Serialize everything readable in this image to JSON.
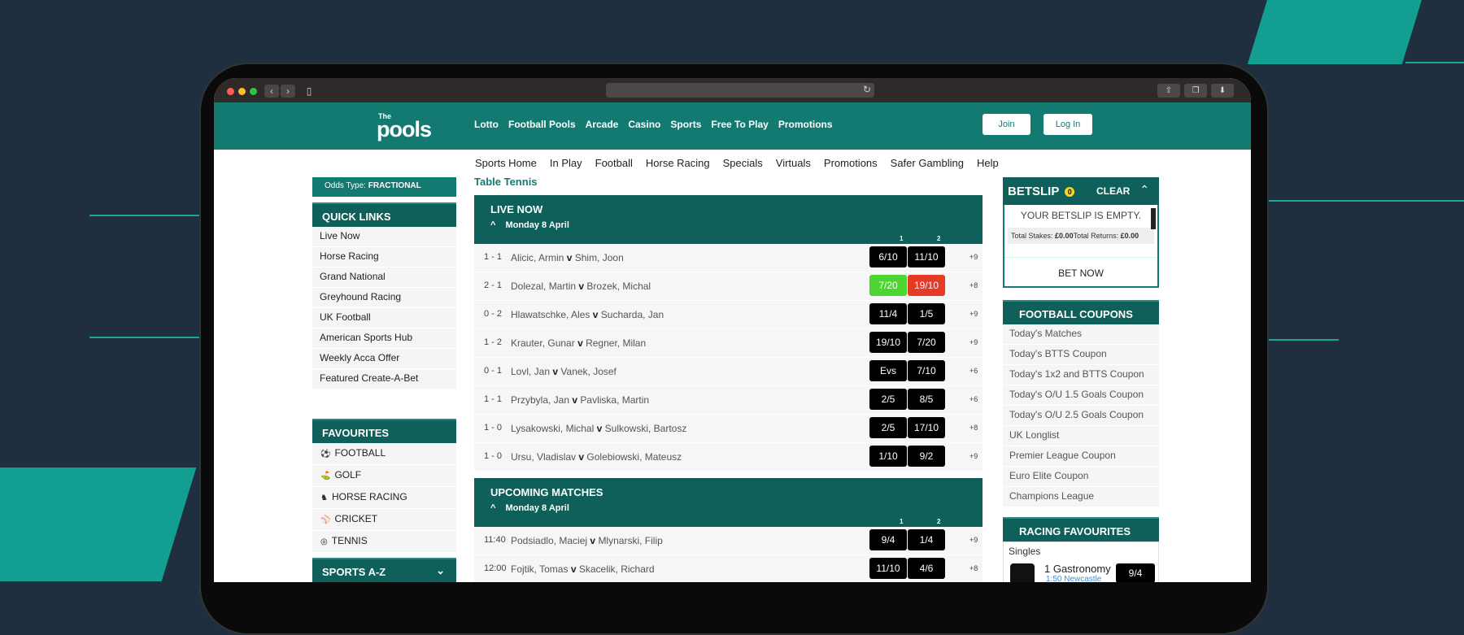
{
  "browser": {
    "back_icon": "chevron-left-icon",
    "forward_icon": "chevron-right-icon",
    "reload_icon": "reload-icon"
  },
  "header": {
    "logo_the": "The",
    "logo_pools": "pools",
    "nav": [
      "Lotto",
      "Football Pools",
      "Arcade",
      "Casino",
      "Sports",
      "Free To Play",
      "Promotions"
    ],
    "join": "Join",
    "login": "Log In"
  },
  "subnav": [
    "Sports Home",
    "In Play",
    "Football",
    "Horse Racing",
    "Specials",
    "Virtuals",
    "Promotions",
    "Safer Gambling",
    "Help"
  ],
  "sidebar": {
    "odds_type_label": "Odds Type:",
    "odds_type_value": "FRACTIONAL",
    "quick_links_title": "QUICK LINKS",
    "quick_links": [
      "Live Now",
      "Horse Racing",
      "Grand National",
      "Greyhound Racing",
      "UK Football",
      "American Sports Hub",
      "Weekly Acca Offer",
      "Featured Create-A-Bet"
    ],
    "favourites_title": "FAVOURITES",
    "favourites": [
      {
        "label": "FOOTBALL",
        "icon": "football-icon",
        "glyph": "⚽"
      },
      {
        "label": "GOLF",
        "icon": "golf-icon",
        "glyph": "⛳"
      },
      {
        "label": "HORSE RACING",
        "icon": "horse-icon",
        "glyph": "♞"
      },
      {
        "label": "CRICKET",
        "icon": "cricket-icon",
        "glyph": "⚾"
      },
      {
        "label": "TENNIS",
        "icon": "tennis-icon",
        "glyph": "◎"
      }
    ],
    "sports_az": "SPORTS A-Z"
  },
  "main": {
    "section_title": "Table Tennis",
    "live_title": "LIVE NOW",
    "live_date": "Monday 8 April",
    "col1": "1",
    "col2": "2",
    "live_matches": [
      {
        "score": "1 - 1",
        "home": "Alicic, Armin",
        "away": "Shim, Joon",
        "odd1": "6/10",
        "odd2": "11/10",
        "more": "+9",
        "c1": "",
        "c2": ""
      },
      {
        "score": "2 - 1",
        "home": "Dolezal, Martin",
        "away": "Brozek, Michal",
        "odd1": "7/20",
        "odd2": "19/10",
        "more": "+8",
        "c1": "green",
        "c2": "red"
      },
      {
        "score": "0 - 2",
        "home": "Hlawatschke, Ales",
        "away": "Sucharda, Jan",
        "odd1": "11/4",
        "odd2": "1/5",
        "more": "+9",
        "c1": "",
        "c2": ""
      },
      {
        "score": "1 - 2",
        "home": "Krauter, Gunar",
        "away": "Regner, Milan",
        "odd1": "19/10",
        "odd2": "7/20",
        "more": "+9",
        "c1": "",
        "c2": ""
      },
      {
        "score": "0 - 1",
        "home": "Lovl, Jan",
        "away": "Vanek, Josef",
        "odd1": "Evs",
        "odd2": "7/10",
        "more": "+6",
        "c1": "",
        "c2": ""
      },
      {
        "score": "1 - 1",
        "home": "Przybyla, Jan",
        "away": "Pavliska, Martin",
        "odd1": "2/5",
        "odd2": "8/5",
        "more": "+6",
        "c1": "",
        "c2": ""
      },
      {
        "score": "1 - 0",
        "home": "Lysakowski, Michal",
        "away": "Sulkowski, Bartosz",
        "odd1": "2/5",
        "odd2": "17/10",
        "more": "+8",
        "c1": "",
        "c2": ""
      },
      {
        "score": "1 - 0",
        "home": "Ursu, Vladislav",
        "away": "Golebiowski, Mateusz",
        "odd1": "1/10",
        "odd2": "9/2",
        "more": "+9",
        "c1": "",
        "c2": ""
      }
    ],
    "upcoming_title": "UPCOMING MATCHES",
    "upcoming_date": "Monday 8 April",
    "upcoming_matches": [
      {
        "score": "11:40",
        "home": "Podsiadlo, Maciej",
        "away": "Mlynarski, Filip",
        "odd1": "9/4",
        "odd2": "1/4",
        "more": "+9",
        "c1": "",
        "c2": ""
      },
      {
        "score": "12:00",
        "home": "Fojtik, Tomas",
        "away": "Skacelik, Richard",
        "odd1": "11/10",
        "odd2": "4/6",
        "more": "+8",
        "c1": "",
        "c2": ""
      }
    ],
    "v": "v"
  },
  "betslip": {
    "title": "BETSLIP",
    "count": "0",
    "clear": "CLEAR",
    "empty": "YOUR BETSLIP IS EMPTY.",
    "stakes_label": "Total Stakes:",
    "stakes_value": "£0.00",
    "returns_label": "Total Returns:",
    "returns_value": "£0.00",
    "bet_now": "BET NOW"
  },
  "coupons": {
    "title": "FOOTBALL COUPONS",
    "items": [
      "Today's Matches",
      "Today's BTTS Coupon",
      "Today's 1x2 and BTTS Coupon",
      "Today's O/U 1.5 Goals Coupon",
      "Today's O/U 2.5 Goals Coupon",
      "UK Longlist",
      "Premier League Coupon",
      "Euro Elite Coupon",
      "Champions League"
    ]
  },
  "racing": {
    "title": "RACING FAVOURITES",
    "type": "Singles",
    "runner": "1 Gastronomy",
    "meeting": "1:50 Newcastle",
    "odd": "9/4"
  },
  "colors": {
    "brand": "#137a72",
    "brand_dark": "#0f5f5a",
    "background": "#1f2f3f",
    "accent": "#129f92"
  }
}
